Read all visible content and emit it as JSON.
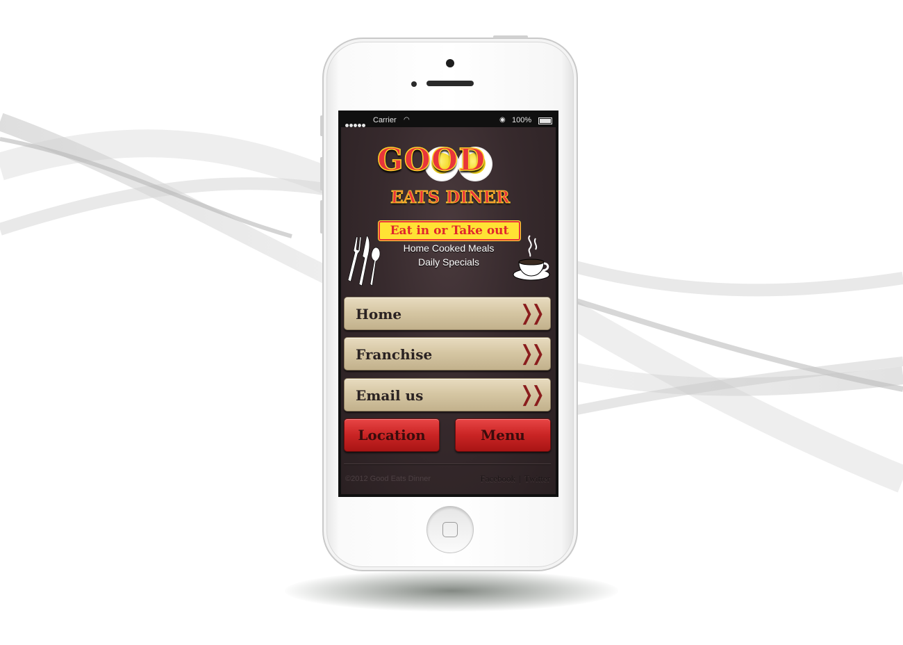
{
  "status_bar": {
    "carrier": "Carrier",
    "battery": "100%"
  },
  "logo": {
    "title": "GOOD",
    "subtitle": "EATS DINER",
    "tagline": "Eat in or Take out",
    "feature_1": "Home Cooked Meals",
    "feature_2": "Daily Specials"
  },
  "nav": {
    "items": [
      {
        "label": "Home",
        "icon": "double-chevron-right-icon"
      },
      {
        "label": "Franchise",
        "icon": "double-chevron-right-icon"
      },
      {
        "label": "Email us",
        "icon": "double-chevron-right-icon"
      }
    ],
    "location_label": "Location",
    "menu_label": "Menu"
  },
  "footer": {
    "copyright": "©2012 Good Eats Dinner",
    "facebook": "Facebook",
    "separator": "|",
    "twitter": "Twitter"
  },
  "colors": {
    "brand_red": "#e8353b",
    "brand_yellow": "#ffd42a",
    "button_tan": "#d6c7a4",
    "button_red": "#c92424",
    "screen_bg": "#372a2d"
  }
}
